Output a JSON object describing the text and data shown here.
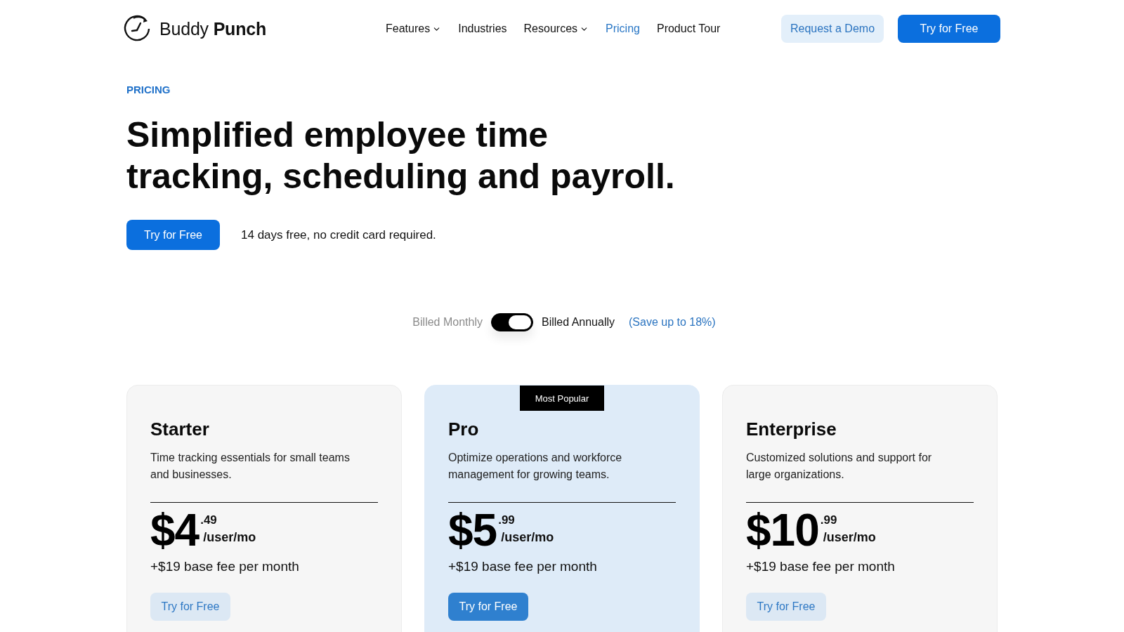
{
  "header": {
    "logo": "Buddy **Punch**",
    "nav": [
      {
        "label": "Features",
        "has_menu": true,
        "selected": false
      },
      {
        "label": "Industries",
        "has_menu": false,
        "selected": false
      },
      {
        "label": "Resources",
        "has_menu": true,
        "selected": false
      },
      {
        "label": "Pricing",
        "has_menu": false,
        "selected": true
      },
      {
        "label": "Product Tour",
        "has_menu": false,
        "selected": false
      }
    ],
    "buttons": [
      {
        "label": "Request a Demo",
        "kind": "secondary"
      },
      {
        "label": "Try for Free",
        "kind": "primary"
      }
    ]
  },
  "hero": {
    "eyebrow": "PRICING",
    "heading": "Simplified employee time tracking, scheduling and payroll.",
    "cta": "Try for Free",
    "note": "14 days free, no credit card required."
  },
  "billing": {
    "monthly_label": "Billed Monthly",
    "annual_label": "Billed Annually",
    "annual": true,
    "savings": "(Save up to 18%)"
  },
  "plans": [
    {
      "name": "Starter",
      "highlighted": false,
      "description": "Time tracking essentials for small teams and businesses.",
      "price_whole": "$4",
      "price_cents": ".49",
      "unit": "/user/mo",
      "fee": "+$19 base fee per month",
      "button": "Try for Free"
    },
    {
      "name": "Pro",
      "highlighted": true,
      "badge": "Most Popular",
      "description": "Optimize operations and workforce management for growing teams.",
      "price_whole": "$5",
      "price_cents": ".99",
      "unit": "/user/mo",
      "fee": "+$19 base fee per month",
      "button": "Try for Free"
    },
    {
      "name": "Enterprise",
      "highlighted": false,
      "description": "Customized solutions and support for large organizations.",
      "price_whole": "$10",
      "price_cents": ".99",
      "unit": "/user/mo",
      "fee": "+$19 base fee per month",
      "button": "Try for Free"
    }
  ]
}
